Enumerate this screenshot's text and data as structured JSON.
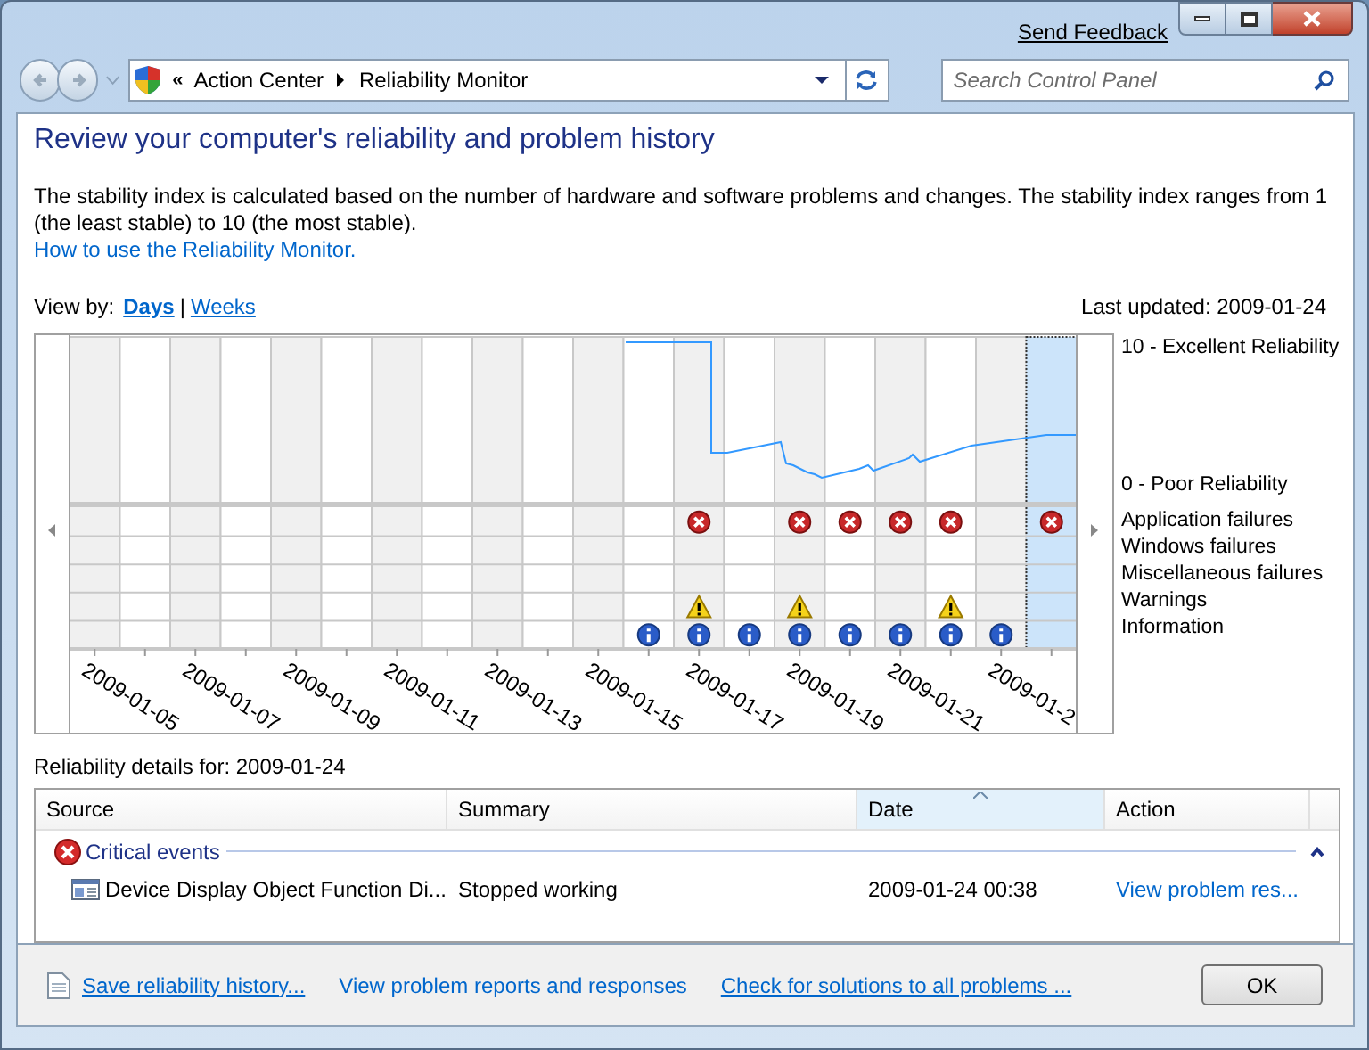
{
  "window": {
    "send_feedback": "Send Feedback"
  },
  "address_bar": {
    "overflow": "«",
    "crumbs": [
      "Action Center",
      "Reliability Monitor"
    ]
  },
  "search": {
    "placeholder": "Search Control Panel"
  },
  "heading": "Review your computer's reliability and problem history",
  "description": "The stability index is calculated based on the number of hardware and software problems and changes. The stability index ranges from 1 (the least stable) to 10 (the most stable).",
  "help_link": "How to use the Reliability Monitor.",
  "view_by": {
    "label": "View by:",
    "separator": "|",
    "options": [
      {
        "label": "Days",
        "selected": true
      },
      {
        "label": "Weeks",
        "selected": false
      }
    ]
  },
  "last_updated": "Last updated: 2009-01-24",
  "chart": {
    "event_rows": [
      "Application failures",
      "Windows failures",
      "Miscellaneous failures",
      "Warnings",
      "Information"
    ],
    "days": [
      {
        "label": "2009-01-05",
        "selected": false,
        "app_failure": false,
        "warning": false,
        "info": false
      },
      {
        "selected": false,
        "app_failure": false,
        "warning": false,
        "info": false
      },
      {
        "label": "2009-01-07",
        "selected": false,
        "app_failure": false,
        "warning": false,
        "info": false
      },
      {
        "selected": false,
        "app_failure": false,
        "warning": false,
        "info": false
      },
      {
        "label": "2009-01-09",
        "selected": false,
        "app_failure": false,
        "warning": false,
        "info": false
      },
      {
        "selected": false,
        "app_failure": false,
        "warning": false,
        "info": false
      },
      {
        "label": "2009-01-11",
        "selected": false,
        "app_failure": false,
        "warning": false,
        "info": false
      },
      {
        "selected": false,
        "app_failure": false,
        "warning": false,
        "info": false
      },
      {
        "label": "2009-01-13",
        "selected": false,
        "app_failure": false,
        "warning": false,
        "info": false
      },
      {
        "selected": false,
        "app_failure": false,
        "warning": false,
        "info": false
      },
      {
        "label": "2009-01-15",
        "selected": false,
        "app_failure": false,
        "warning": false,
        "info": false
      },
      {
        "selected": false,
        "app_failure": false,
        "warning": false,
        "info": true
      },
      {
        "label": "2009-01-17",
        "selected": false,
        "app_failure": true,
        "warning": true,
        "info": true
      },
      {
        "selected": false,
        "app_failure": false,
        "warning": false,
        "info": true
      },
      {
        "label": "2009-01-19",
        "selected": false,
        "app_failure": true,
        "warning": true,
        "info": true
      },
      {
        "selected": false,
        "app_failure": true,
        "warning": false,
        "info": true
      },
      {
        "label": "2009-01-21",
        "selected": false,
        "app_failure": true,
        "warning": false,
        "info": true
      },
      {
        "selected": false,
        "app_failure": true,
        "warning": true,
        "info": true
      },
      {
        "label": "2009-01-2",
        "selected": false,
        "app_failure": false,
        "warning": false,
        "info": true
      },
      {
        "selected": true,
        "app_failure": true,
        "warning": false,
        "info": false
      }
    ],
    "scale_labels": [
      "10 - Excellent Reliability",
      "0 - Poor Reliability"
    ]
  },
  "details_label": "Reliability details for: 2009-01-24",
  "table": {
    "columns": [
      {
        "label": "Source",
        "sorted": false
      },
      {
        "label": "Summary",
        "sorted": false
      },
      {
        "label": "Date",
        "sorted": true
      },
      {
        "label": "Action",
        "sorted": false
      }
    ],
    "groups": [
      {
        "label": "Critical events",
        "expanded": true,
        "rows": [
          {
            "source": "Device Display Object Function Di...",
            "summary": "Stopped working",
            "date": "2009-01-24 00:38",
            "action": "View problem res..."
          }
        ]
      }
    ]
  },
  "footer_links": [
    {
      "label": "Save reliability history...",
      "underlined": true
    },
    {
      "label": "View problem reports and responses",
      "underlined": false
    },
    {
      "label": "Check for solutions to all problems ...",
      "underlined": true
    }
  ],
  "ok_button": "OK"
}
